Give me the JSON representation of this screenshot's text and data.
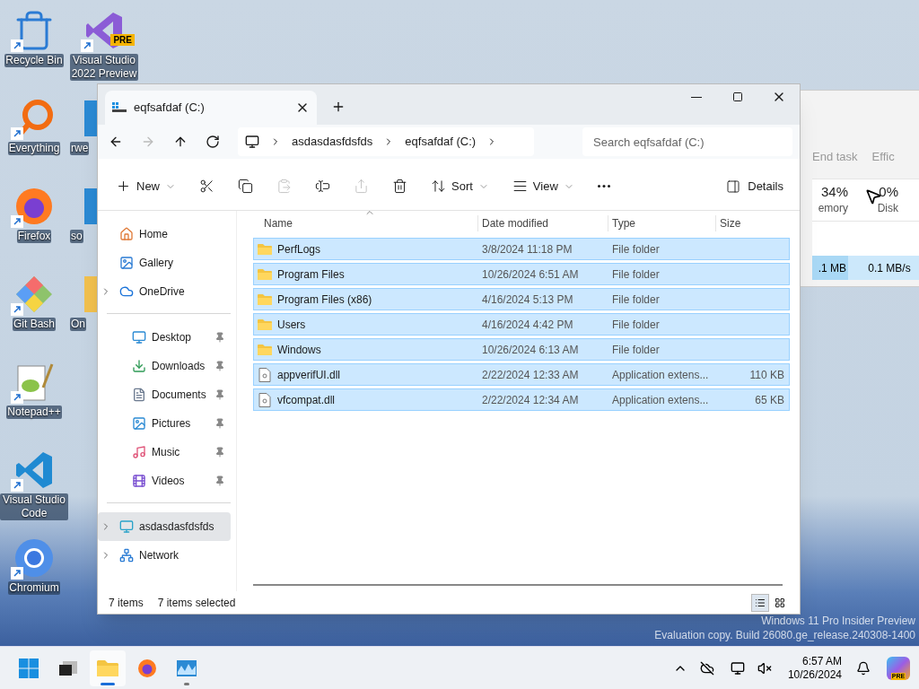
{
  "desktop_icons": [
    {
      "label": "Recycle Bin",
      "kind": "recycle"
    },
    {
      "label": "Everything",
      "kind": "everything"
    },
    {
      "label": "Firefox",
      "kind": "firefox"
    },
    {
      "label": "Git Bash",
      "kind": "gitbash"
    },
    {
      "label": "Notepad++",
      "kind": "notepad"
    },
    {
      "label": "Visual Studio Code",
      "kind": "vscode"
    },
    {
      "label": "Chromium",
      "kind": "chromium"
    }
  ],
  "desktop_icons_2": [
    {
      "label": "Visual Studio 2022 Preview",
      "badge": "PRE",
      "kind": "vs"
    },
    {
      "label": "rwe",
      "kind": "tile"
    },
    {
      "label": "so",
      "kind": "tile"
    },
    {
      "label": "On",
      "kind": "folder"
    }
  ],
  "task_manager": {
    "end_task": "End task",
    "efficiency": "Effic",
    "memory_value": "34%",
    "memory_label": "emory",
    "disk_value": "0%",
    "disk_label": "Disk",
    "row_memory": ".1 MB",
    "row_disk": "0.1 MB/s"
  },
  "explorer": {
    "tab_title": "eqfsafdaf (C:)",
    "breadcrumbs": [
      "asdasdasfdsfds",
      "eqfsafdaf (C:)"
    ],
    "search": {
      "placeholder": "Search eqfsafdaf (C:)"
    },
    "toolbar": [
      {
        "kind": "new",
        "label": "New",
        "disabled": false
      },
      {
        "kind": "cut",
        "disabled": false
      },
      {
        "kind": "copy",
        "disabled": false
      },
      {
        "kind": "paste",
        "disabled": true
      },
      {
        "kind": "rename",
        "disabled": false
      },
      {
        "kind": "share",
        "disabled": true
      },
      {
        "kind": "delete",
        "disabled": false
      },
      {
        "kind": "sort",
        "label": "Sort",
        "disabled": false
      },
      {
        "kind": "view",
        "label": "View",
        "disabled": false
      },
      {
        "kind": "more",
        "disabled": false
      }
    ],
    "details_button": "Details",
    "sidebar": [
      [
        {
          "label": "Home",
          "kind": "home",
          "expandable": false,
          "pinned": false,
          "selected": false
        },
        {
          "label": "Gallery",
          "kind": "gallery",
          "expandable": false,
          "pinned": false,
          "selected": false
        },
        {
          "label": "OneDrive",
          "kind": "cloud",
          "expandable": true,
          "pinned": false,
          "selected": false
        }
      ],
      [
        {
          "label": "Desktop",
          "kind": "desktop",
          "expandable": false,
          "pinned": true,
          "selected": false
        },
        {
          "label": "Downloads",
          "kind": "download",
          "expandable": false,
          "pinned": true,
          "selected": false
        },
        {
          "label": "Documents",
          "kind": "document",
          "expandable": false,
          "pinned": true,
          "selected": false
        },
        {
          "label": "Pictures",
          "kind": "picture",
          "expandable": false,
          "pinned": true,
          "selected": false
        },
        {
          "label": "Music",
          "kind": "music",
          "expandable": false,
          "pinned": true,
          "selected": false
        },
        {
          "label": "Videos",
          "kind": "video",
          "expandable": false,
          "pinned": true,
          "selected": false
        }
      ],
      [
        {
          "label": "asdasdasfdsfds",
          "kind": "pc",
          "expandable": true,
          "pinned": false,
          "selected": true
        },
        {
          "label": "Network",
          "kind": "network",
          "expandable": true,
          "pinned": false,
          "selected": false
        }
      ]
    ],
    "columns": [
      "Name",
      "Date modified",
      "Type",
      "Size"
    ],
    "rows": [
      {
        "name": "PerfLogs",
        "kind": "folder",
        "date": "3/8/2024 11:18 PM",
        "type": "File folder",
        "selected": true
      },
      {
        "name": "Program Files",
        "kind": "folder",
        "date": "10/26/2024 6:51 AM",
        "type": "File folder",
        "selected": true
      },
      {
        "name": "Program Files (x86)",
        "kind": "folder",
        "date": "4/16/2024 5:13 PM",
        "type": "File folder",
        "selected": true
      },
      {
        "name": "Users",
        "kind": "folder",
        "date": "4/16/2024 4:42 PM",
        "type": "File folder",
        "selected": true
      },
      {
        "name": "Windows",
        "kind": "folder",
        "date": "10/26/2024 6:13 AM",
        "type": "File folder",
        "selected": true
      },
      {
        "name": "appverifUI.dll",
        "kind": "file",
        "date": "2/22/2024 12:33 AM",
        "type": "Application extens...",
        "size": "110 KB",
        "selected": true
      },
      {
        "name": "vfcompat.dll",
        "kind": "file",
        "date": "2/22/2024 12:34 AM",
        "type": "Application extens...",
        "size": "65 KB",
        "selected": true
      }
    ],
    "status": {
      "count": "7 items",
      "selection": "7 items selected"
    },
    "view_modes": [
      {
        "kind": "details",
        "selected": true
      },
      {
        "kind": "tiles",
        "selected": false
      }
    ]
  },
  "watermark": [
    "Windows 11 Pro Insider Preview",
    "Evaluation copy. Build 26080.ge_release.240308-1400"
  ],
  "taskbar": [
    {
      "kind": "start",
      "active": false,
      "running": false
    },
    {
      "kind": "taskview",
      "active": false,
      "running": false
    },
    {
      "kind": "explorer",
      "active": true,
      "running": true
    },
    {
      "kind": "firefox",
      "active": false,
      "running": false
    },
    {
      "kind": "monitor",
      "active": false,
      "running": true
    }
  ],
  "tray": {
    "time": "6:57 AM",
    "date": "10/26/2024",
    "copilot_badge": "PRE"
  }
}
